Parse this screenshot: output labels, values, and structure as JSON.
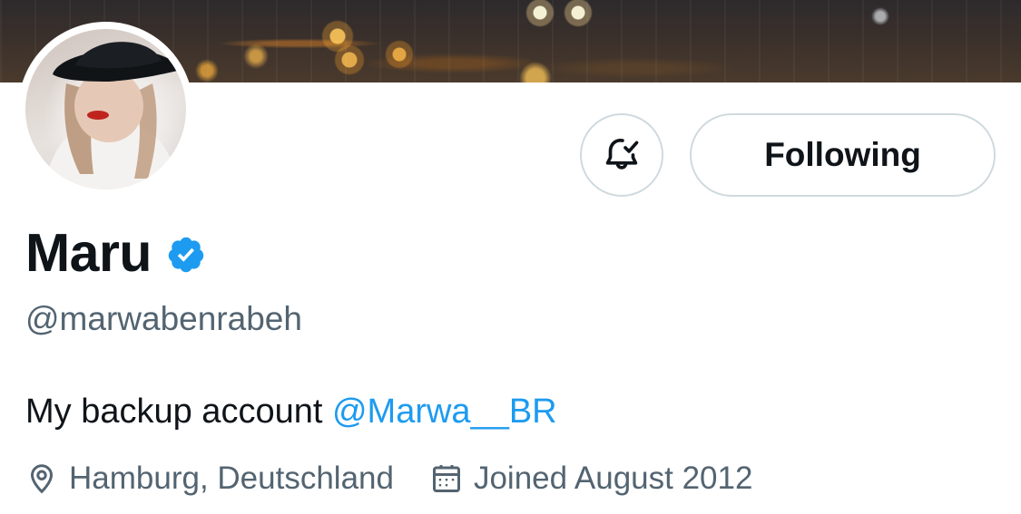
{
  "profile": {
    "display_name": "Maru",
    "verified": true,
    "handle": "@marwabenrabeh",
    "bio_text": "My backup account ",
    "bio_mention": "@Marwa__BR",
    "location": "Hamburg, Deutschland",
    "joined": "Joined August 2012"
  },
  "actions": {
    "notifications_icon": "bell-check-icon",
    "follow_label": "Following"
  },
  "colors": {
    "text_primary": "#0f1419",
    "text_secondary": "#536471",
    "accent": "#1d9bf0",
    "border": "#cfd9de"
  }
}
